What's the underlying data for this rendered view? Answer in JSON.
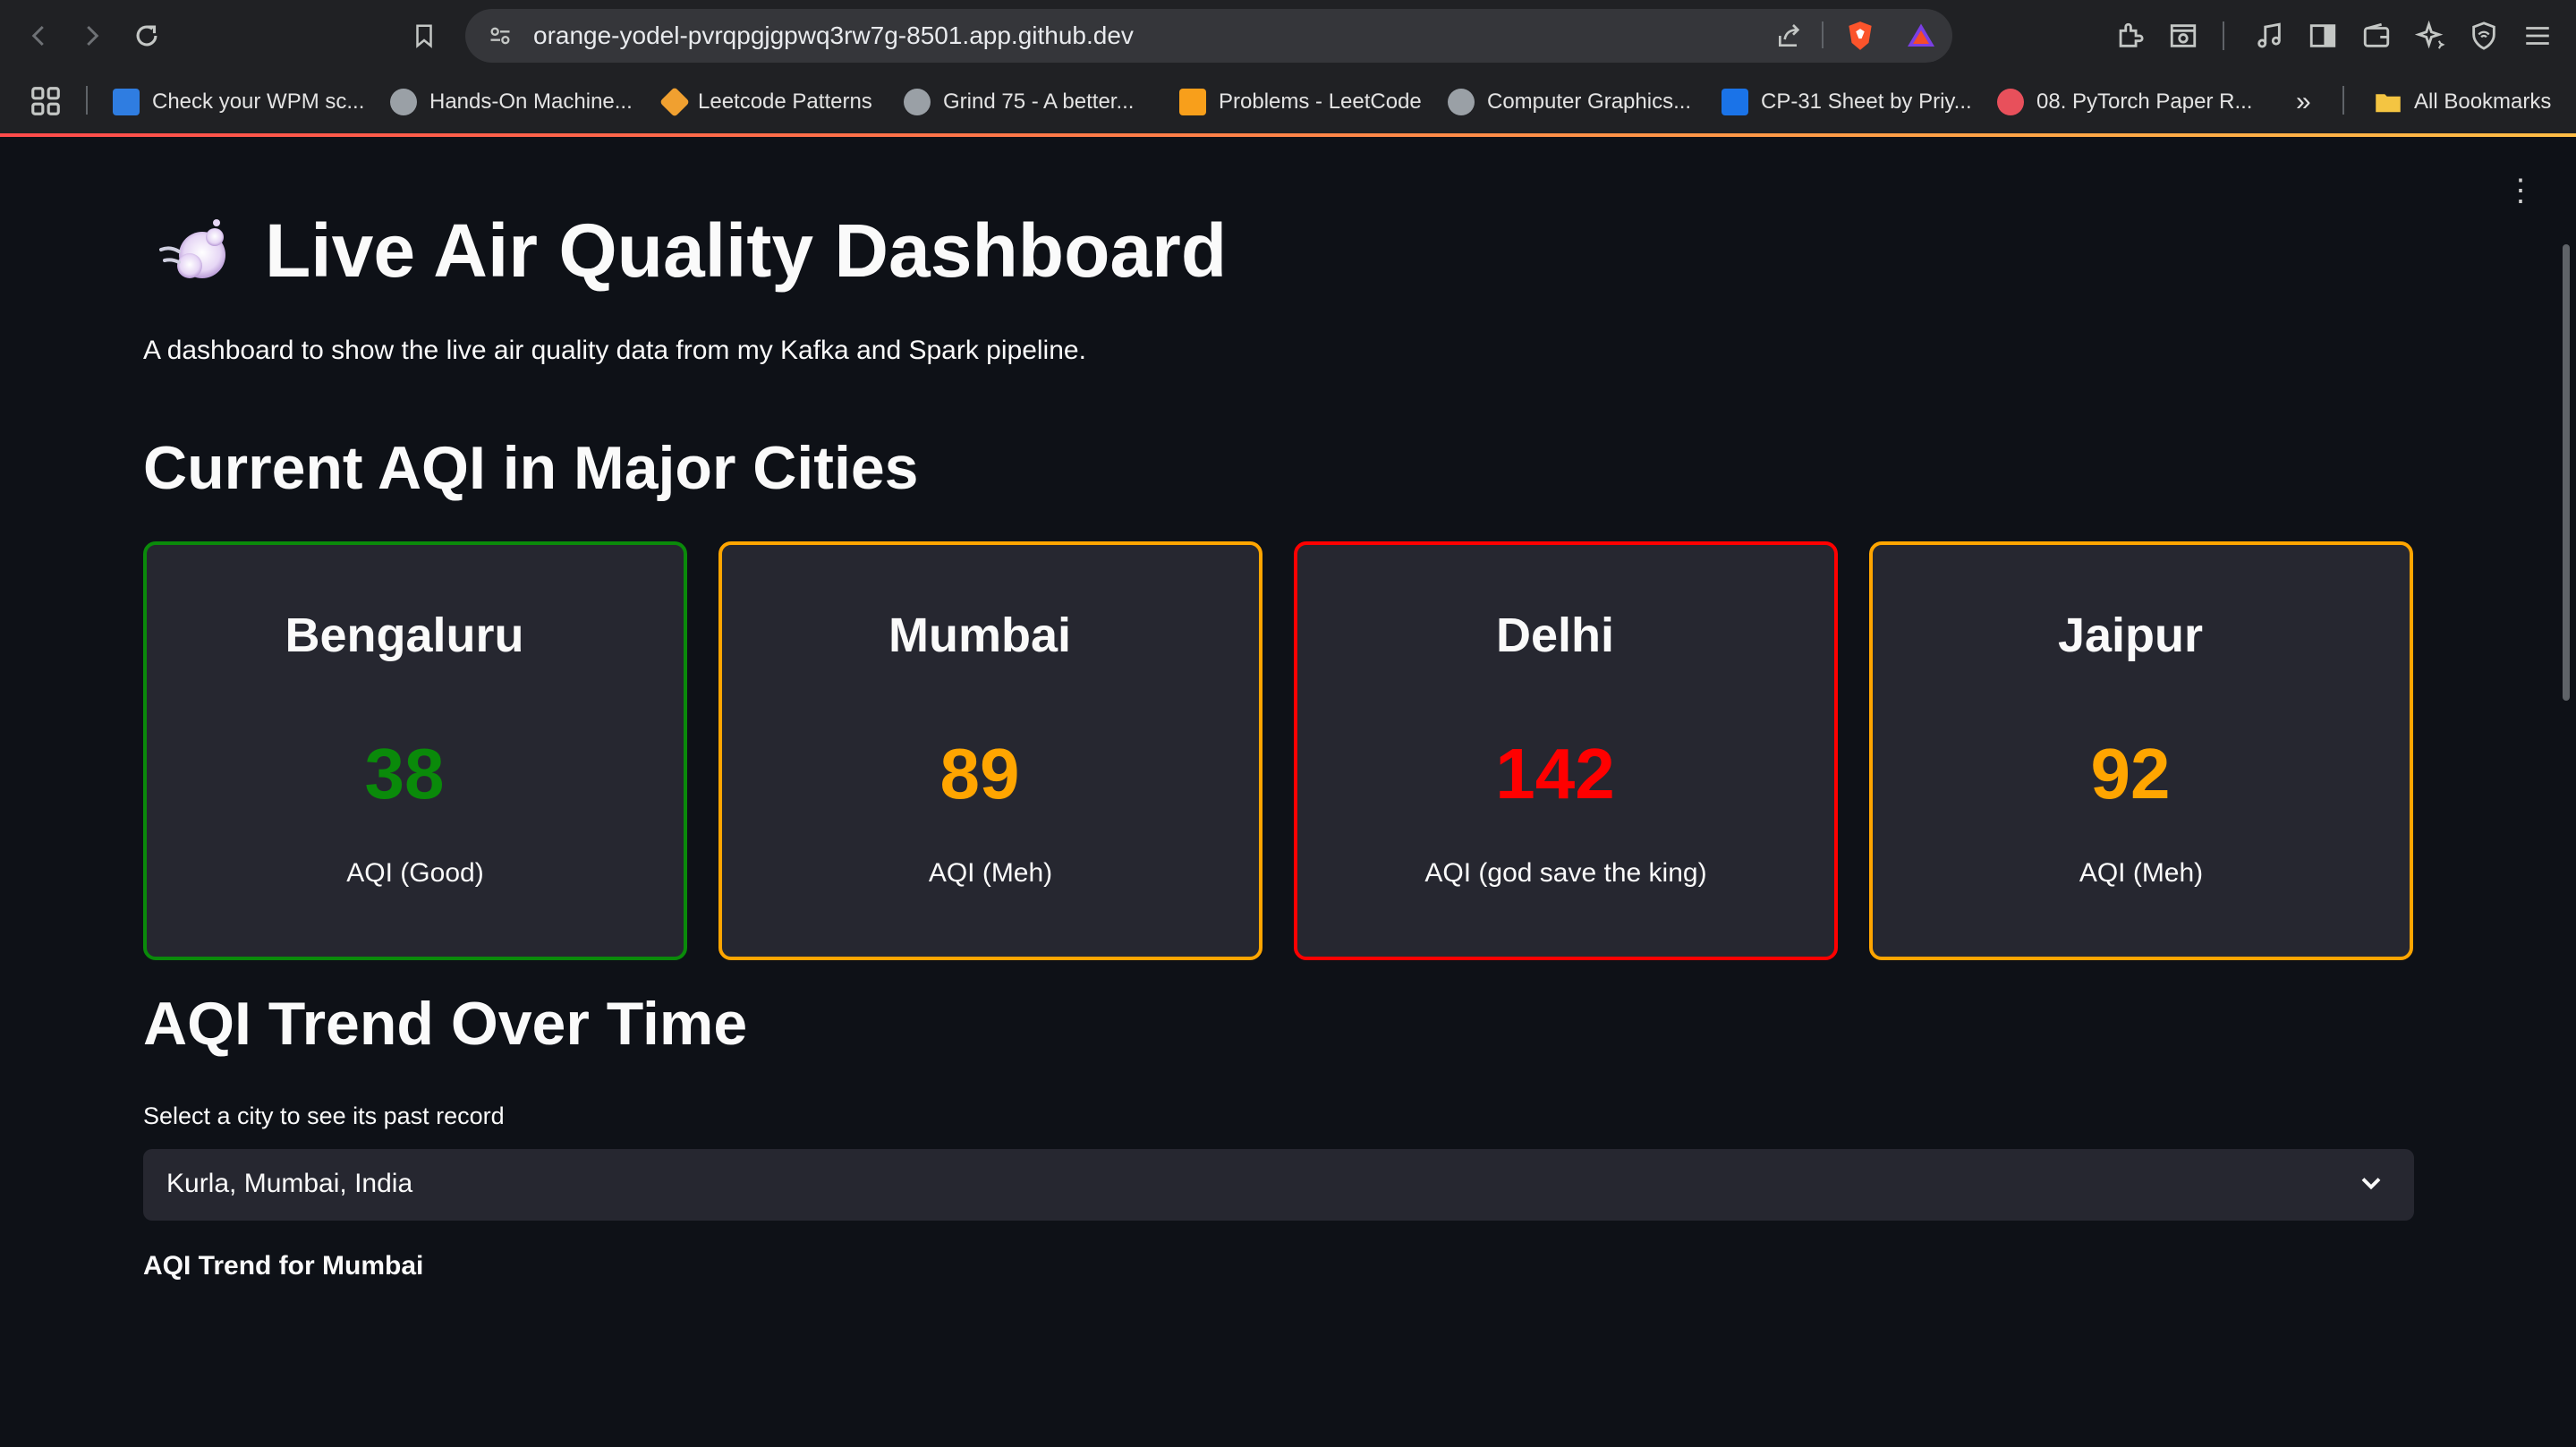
{
  "browser": {
    "url": "orange-yodel-pvrqpgjgpwq3rw7g-8501.app.github.dev",
    "bookmarks": [
      {
        "label": "Check your WPM sc...",
        "color": "#2f7de1"
      },
      {
        "label": "Hands-On Machine...",
        "color": "#9aa0a6"
      },
      {
        "label": "Leetcode Patterns",
        "color": "#f0a030"
      },
      {
        "label": "Grind 75 - A better...",
        "color": "#9aa0a6"
      },
      {
        "label": "Problems - LeetCode",
        "color": "#f89f1b"
      },
      {
        "label": "Computer Graphics...",
        "color": "#9aa0a6"
      },
      {
        "label": "CP-31 Sheet by Priy...",
        "color": "#1a73e8"
      },
      {
        "label": "08. PyTorch Paper R...",
        "color": "#e8505b"
      }
    ],
    "more_bookmarks": "»",
    "all_bookmarks": "All Bookmarks"
  },
  "app": {
    "title": "Live Air Quality Dashboard",
    "subtitle": "A dashboard to show the live air quality data from my Kafka and Spark pipeline.",
    "current_heading": "Current AQI in Major Cities",
    "cities": [
      {
        "name": "Bengaluru",
        "aqi": "38",
        "label": "AQI (Good)",
        "color": "#0a8a0a"
      },
      {
        "name": "Mumbai",
        "aqi": "89",
        "label": "AQI (Meh)",
        "color": "#ffa500"
      },
      {
        "name": "Delhi",
        "aqi": "142",
        "label": "AQI (god save the king)",
        "color": "#ff0000"
      },
      {
        "name": "Jaipur",
        "aqi": "92",
        "label": "AQI (Meh)",
        "color": "#ffa500"
      }
    ],
    "trend_heading": "AQI Trend Over Time",
    "select_label": "Select a city to see its past record",
    "select_value": "Kurla, Mumbai, India",
    "trend_subheading": "AQI Trend for Mumbai"
  }
}
